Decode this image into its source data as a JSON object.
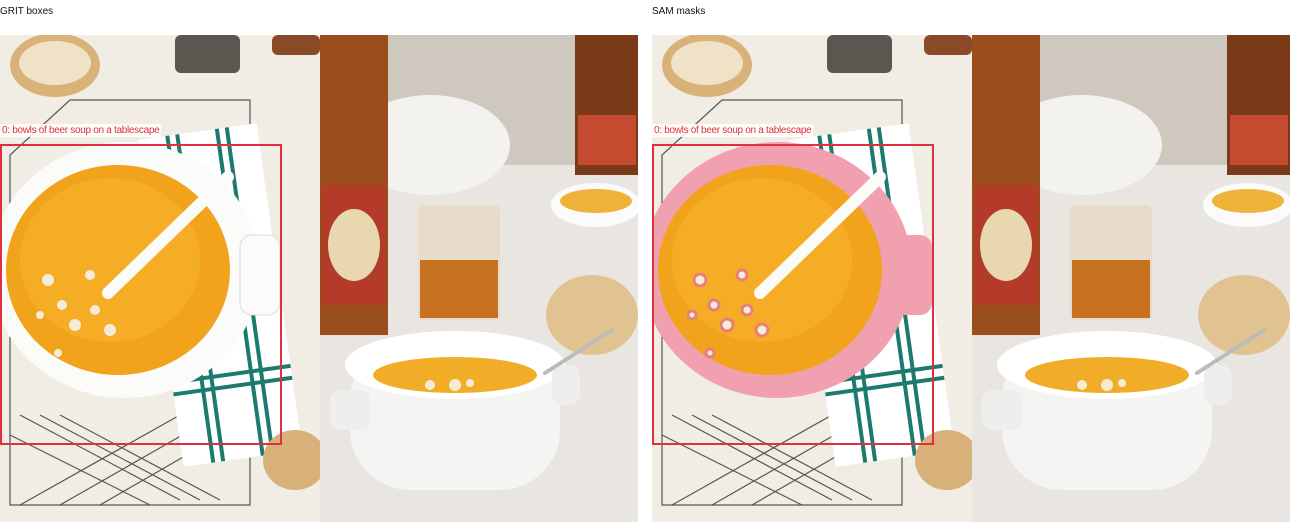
{
  "panels": [
    {
      "title": "GRIT boxes",
      "mode": "box"
    },
    {
      "title": "SAM masks",
      "mode": "mask"
    }
  ],
  "detection": {
    "label": "0: bowls of beer soup on a tablescape",
    "color": "#e03040"
  },
  "mask_color": "#f08aa0",
  "scene": "overhead bowl of orange beer soup with white spoon on plaid towel and cooling rack; second white mug of soup with beer bottle and glass of beer"
}
